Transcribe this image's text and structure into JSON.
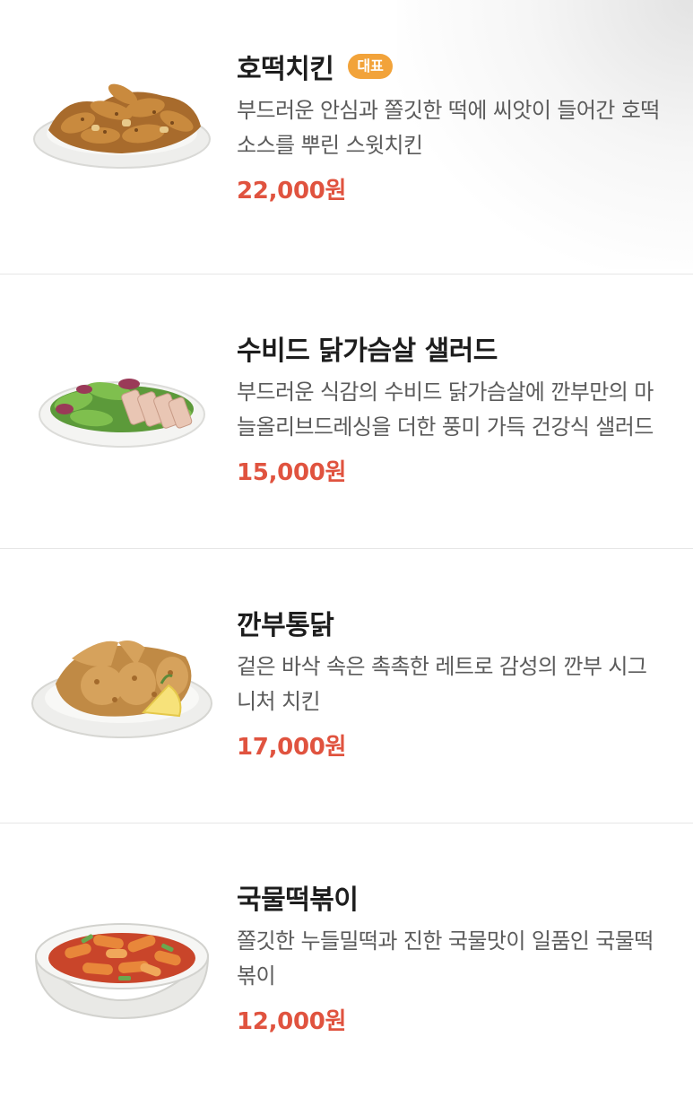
{
  "menu": {
    "items": [
      {
        "name": "호떡치킨",
        "badge": "대표",
        "description": "부드러운 안심과 쫄깃한 떡에 씨앗이 들어간 호떡소스를 뿌린 스윗치킨",
        "price": "22,000원",
        "image_icon": "fried-chicken-icon"
      },
      {
        "name": "수비드 닭가슴살 샐러드",
        "description": "부드러운 식감의 수비드 닭가슴살에 깐부만의 마늘올리브드레싱을 더한 풍미 가득 건강식 샐러드",
        "price": "15,000원",
        "image_icon": "salad-icon"
      },
      {
        "name": "깐부통닭",
        "description": "겉은 바삭 속은 촉촉한 레트로 감성의 깐부 시그니처 치킨",
        "price": "17,000원",
        "image_icon": "whole-chicken-icon"
      },
      {
        "name": "국물떡볶이",
        "description": "쫄깃한 누들밀떡과 진한 국물맛이 일품인 국물떡볶이",
        "price": "12,000원",
        "image_icon": "tteokbokki-icon"
      }
    ]
  },
  "colors": {
    "price": "#e0533f",
    "badge": "#f2a33a",
    "name": "#1d1d1d",
    "description": "#5b5b5b",
    "divider": "#e6e6e6"
  }
}
